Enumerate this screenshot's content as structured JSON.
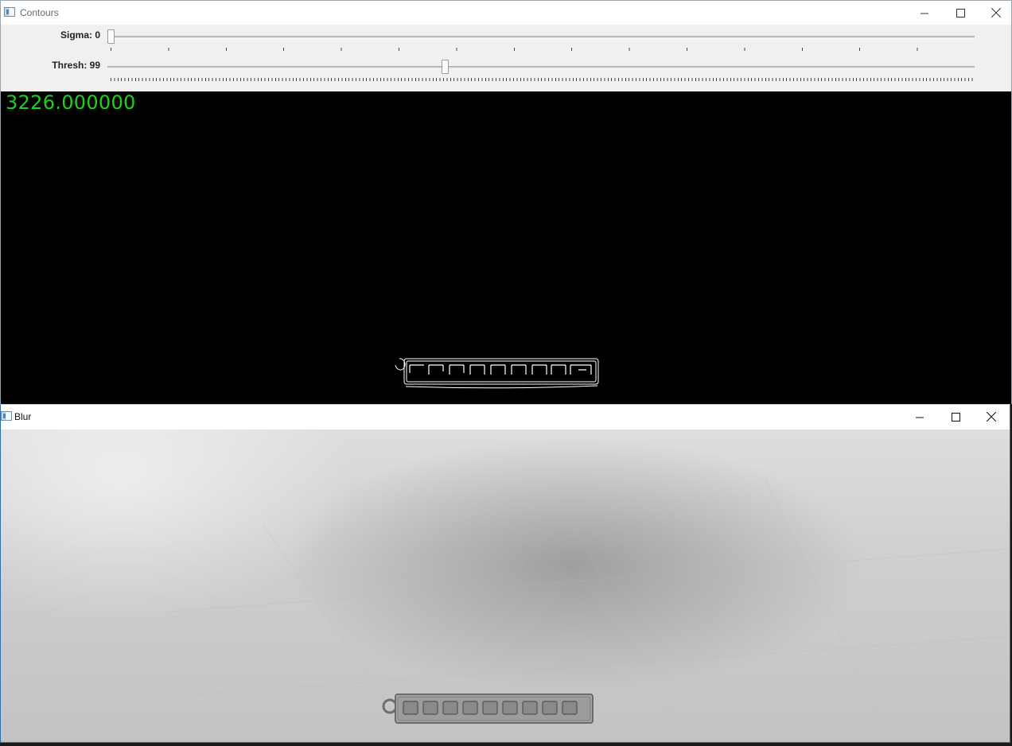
{
  "contours_window": {
    "title": "Contours",
    "controls": {
      "minimize": "minimize",
      "maximize": "maximize",
      "close": "close"
    },
    "trackbars": [
      {
        "label": "Sigma: 0",
        "value": 0,
        "max": 15
      },
      {
        "label": "Thresh: 99",
        "value": 99,
        "max": 255
      }
    ],
    "area_readout": "3226.000000",
    "colors": {
      "readout": "#1ed11e",
      "background": "#000000",
      "contour": "#ffffff"
    }
  },
  "blur_window": {
    "title": "Blur",
    "controls": {
      "minimize": "minimize",
      "maximize": "maximize",
      "close": "close"
    }
  }
}
